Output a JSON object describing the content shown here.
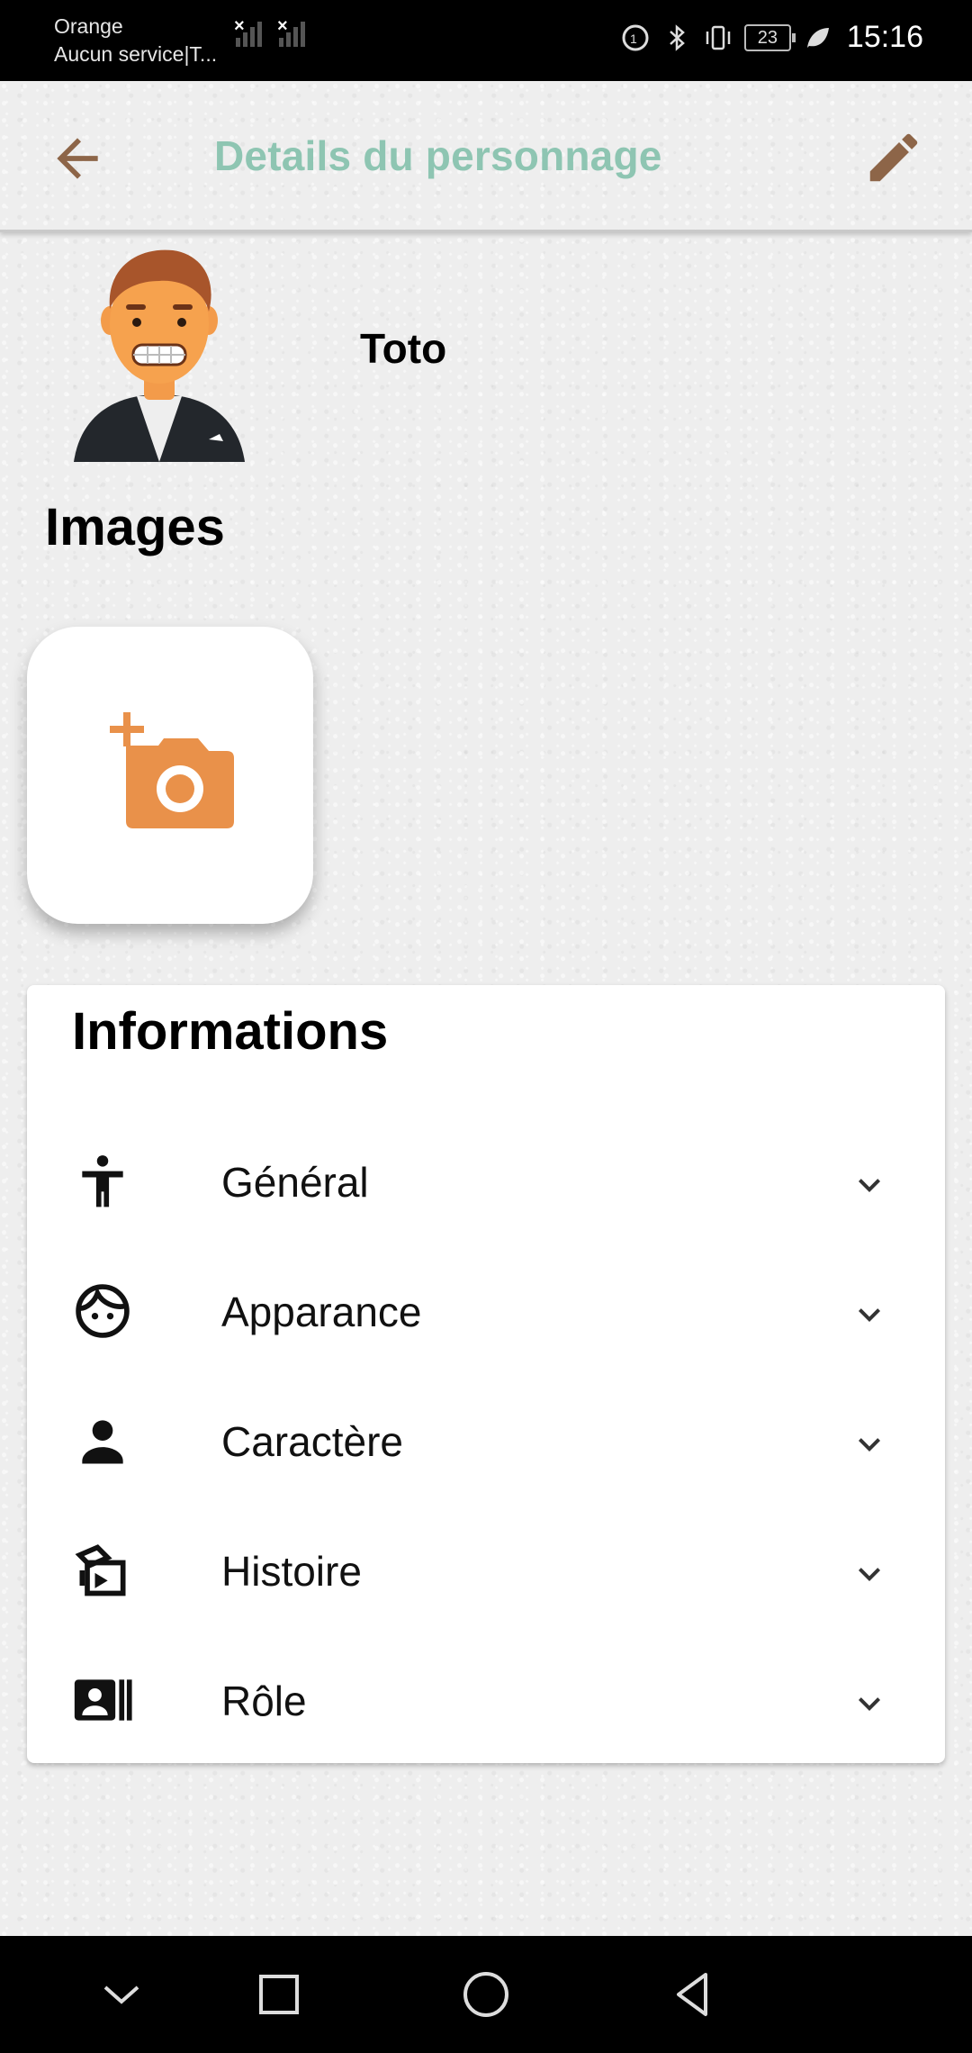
{
  "status_bar": {
    "carrier_line1": "Orange",
    "carrier_line2": "Aucun service|T...",
    "battery": "23",
    "time": "15:16"
  },
  "app_bar": {
    "title": "Details du personnage",
    "back_icon": "arrow-back-icon",
    "edit_icon": "pencil-icon",
    "accent_color": "#8ec5b2",
    "icon_color": "#8d6548"
  },
  "character": {
    "name": "Toto"
  },
  "images": {
    "title": "Images",
    "add_icon": "add-a-photo-icon",
    "add_icon_color": "#e9914a"
  },
  "informations": {
    "title": "Informations",
    "items": [
      {
        "label": "Général",
        "icon": "accessibility-icon"
      },
      {
        "label": "Apparance",
        "icon": "face-icon"
      },
      {
        "label": "Caractère",
        "icon": "person-icon"
      },
      {
        "label": "Histoire",
        "icon": "history-book-icon"
      },
      {
        "label": "Rôle",
        "icon": "badge-icon"
      }
    ]
  },
  "nav_bar": {
    "buttons": [
      "chevron-down-icon",
      "square-icon",
      "circle-home-icon",
      "triangle-back-icon"
    ]
  }
}
